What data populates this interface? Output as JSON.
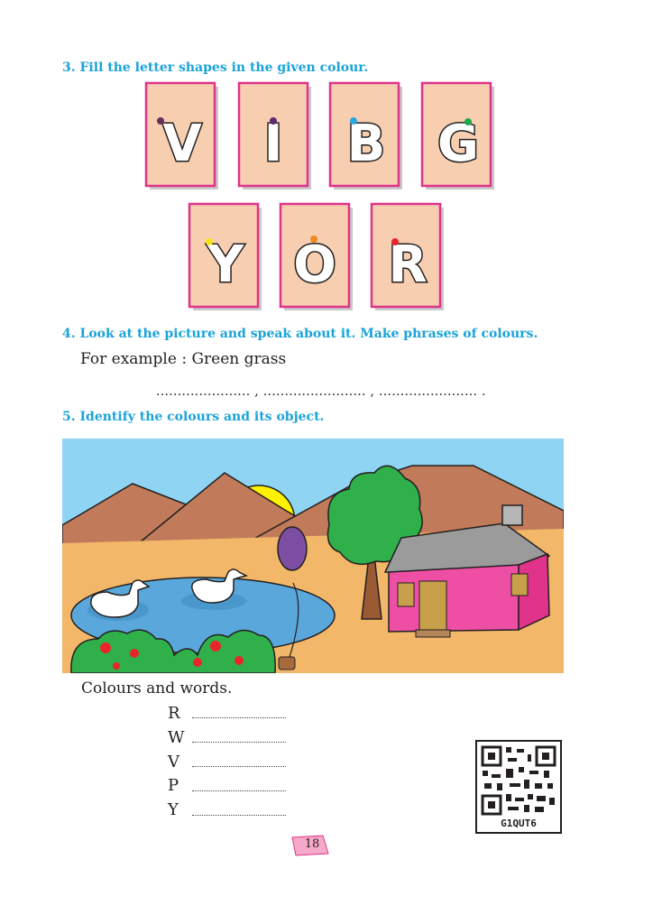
{
  "q3": {
    "heading": "3. Fill the letter shapes in the given colour.",
    "cards": [
      {
        "letter": "V",
        "dot_color": "#6b2d5c"
      },
      {
        "letter": "I",
        "dot_color": "#5b2c6f"
      },
      {
        "letter": "B",
        "dot_color": "#29a7df"
      },
      {
        "letter": "G",
        "dot_color": "#1fa84a"
      },
      {
        "letter": "Y",
        "dot_color": "#f5e31a"
      },
      {
        "letter": "O",
        "dot_color": "#f08a24"
      },
      {
        "letter": "R",
        "dot_color": "#e8262a"
      }
    ]
  },
  "q4": {
    "heading": "4. Look at the picture and speak about it. Make phrases of colours.",
    "example": "For example : Green grass",
    "blanks": "...................... , ........................ , ....................... ."
  },
  "q5": {
    "heading": "5. Identify the colours and its object.",
    "colours_label": "Colours and words.",
    "rows": [
      "R",
      "W",
      "V",
      "P",
      "Y"
    ]
  },
  "qr": {
    "code": "G1QUT6"
  },
  "page_number": "18",
  "colors": {
    "heading": "#1aa3d9",
    "card_fill": "#f7cfb0",
    "card_border": "#e0338a",
    "page_tab": "#f6a9c8"
  }
}
